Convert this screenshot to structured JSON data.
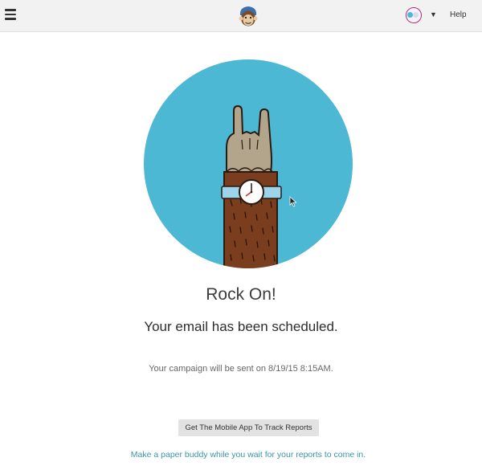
{
  "header": {
    "menu_icon": "hamburger-menu-icon",
    "logo_icon": "freddie-monkey-logo-icon",
    "account_icon": "account-avatar-icon",
    "account_menu_icon": "chevron-down-icon",
    "help_label": "Help"
  },
  "confirmation": {
    "illustration": "rock-on-hand-with-watch-illustration",
    "title": "Rock On!",
    "subtitle": "Your email has been scheduled.",
    "message": "Your campaign will be sent on 8/19/15 8:15AM.",
    "mobile_app_button": "Get The Mobile App To Track Reports",
    "paper_buddy_link": "Make a paper buddy while you wait for your reports to come in."
  },
  "colors": {
    "circle": "#4cb8d4",
    "link": "#3a96a8",
    "button": "#e2e2e2"
  }
}
